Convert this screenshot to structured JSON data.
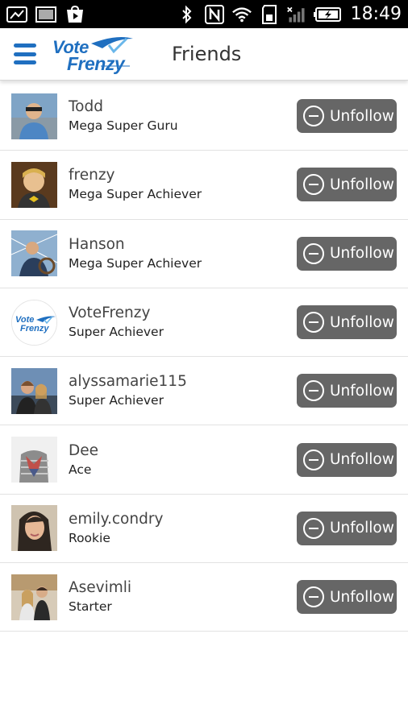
{
  "status_bar": {
    "time": "18:49",
    "icons": [
      "image-icon",
      "gallery-icon",
      "play-store-icon",
      "bluetooth-icon",
      "nfc-icon",
      "wifi-icon",
      "sd-card-icon",
      "signal-icon",
      "battery-charging-icon"
    ]
  },
  "header": {
    "logo_line1": "Vote",
    "logo_line2": "Frenzy",
    "title": "Friends"
  },
  "friends": [
    {
      "name": "Todd",
      "rank": "Mega Super Guru",
      "button": "Unfollow"
    },
    {
      "name": "frenzy",
      "rank": "Mega Super Achiever",
      "button": "Unfollow"
    },
    {
      "name": "Hanson",
      "rank": "Mega Super Achiever",
      "button": "Unfollow"
    },
    {
      "name": "VoteFrenzy",
      "rank": "Super Achiever",
      "button": "Unfollow",
      "avatar_text_1": "Vote",
      "avatar_text_2": "Frenzy"
    },
    {
      "name": "alyssamarie115",
      "rank": "Super Achiever",
      "button": "Unfollow"
    },
    {
      "name": "Dee",
      "rank": "Ace",
      "button": "Unfollow"
    },
    {
      "name": "emily.condry",
      "rank": "Rookie",
      "button": "Unfollow"
    },
    {
      "name": "Asevimli",
      "rank": "Starter",
      "button": "Unfollow"
    }
  ],
  "colors": {
    "brand_blue": "#1f6fc0",
    "button_gray": "#666666",
    "status_bar": "#000000"
  }
}
